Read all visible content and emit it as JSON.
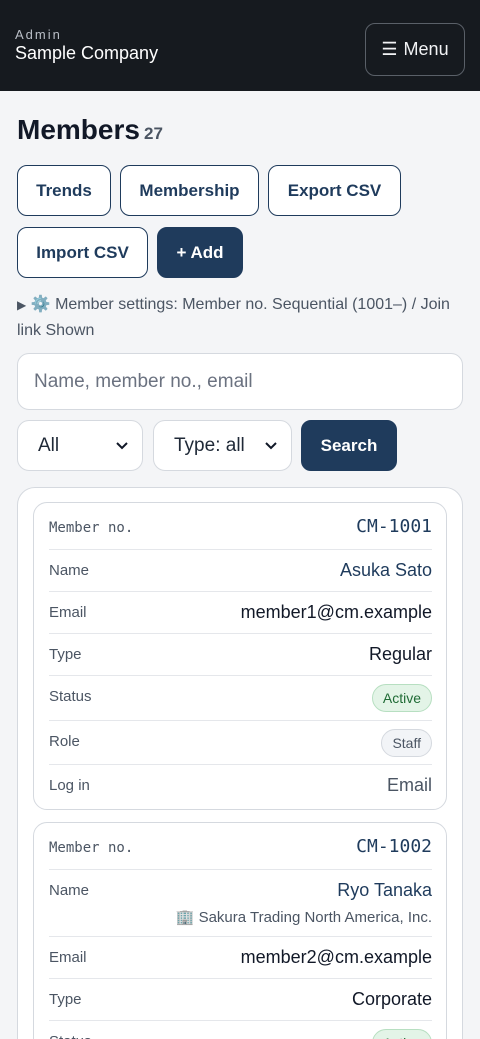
{
  "header": {
    "role": "Admin",
    "company": "Sample Company",
    "menu_icon": "☰",
    "menu_label": "Menu"
  },
  "page": {
    "title": "Members",
    "count": "27"
  },
  "actions": {
    "trends": "Trends",
    "membership": "Membership",
    "export_csv": "Export CSV",
    "import_csv": "Import CSV",
    "add": "+ Add"
  },
  "settings": {
    "arrow": "▶",
    "icon": "⚙️",
    "text": "Member settings: Member no. Sequential (1001–) / Join link Shown"
  },
  "search": {
    "placeholder": "Name, member no., email",
    "status_selected": "All",
    "type_selected": "Type: all",
    "button": "Search"
  },
  "colors": {
    "accent": "#1f3b5c",
    "topbar": "#161a1f",
    "active_badge_bg": "#e3f4e7"
  },
  "field_labels": {
    "member_no": "Member no.",
    "name": "Name",
    "email": "Email",
    "type": "Type",
    "status": "Status",
    "role": "Role",
    "login": "Log in"
  },
  "members": [
    {
      "member_no": "CM-1001",
      "name": "Asuka Sato",
      "email": "member1@cm.example",
      "type": "Regular",
      "status": "Active",
      "role": "Staff",
      "login": "Email"
    },
    {
      "member_no": "CM-1002",
      "name": "Ryo Tanaka",
      "company_icon": "🏢",
      "company": "Sakura Trading North America, Inc.",
      "email": "member2@cm.example",
      "type": "Corporate",
      "status": "Active"
    }
  ]
}
